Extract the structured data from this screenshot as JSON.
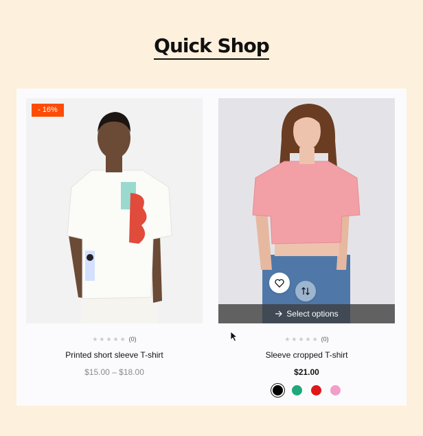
{
  "page": {
    "title": "Quick Shop"
  },
  "products": [
    {
      "badge": "- 16%",
      "rating_count": "(0)",
      "name": "Printed short sleeve T-shirt",
      "price": "$15.00 – $18.00"
    },
    {
      "rating_count": "(0)",
      "name": "Sleeve cropped T-shirt",
      "price": "$21.00",
      "overlay_label": "Select options",
      "swatches": [
        "#000000",
        "#1fa97a",
        "#e01818",
        "#f29fc8"
      ]
    }
  ],
  "icons": [
    "heart-icon",
    "compare-arrows-icon",
    "arrow-right-icon",
    "cursor-icon"
  ]
}
